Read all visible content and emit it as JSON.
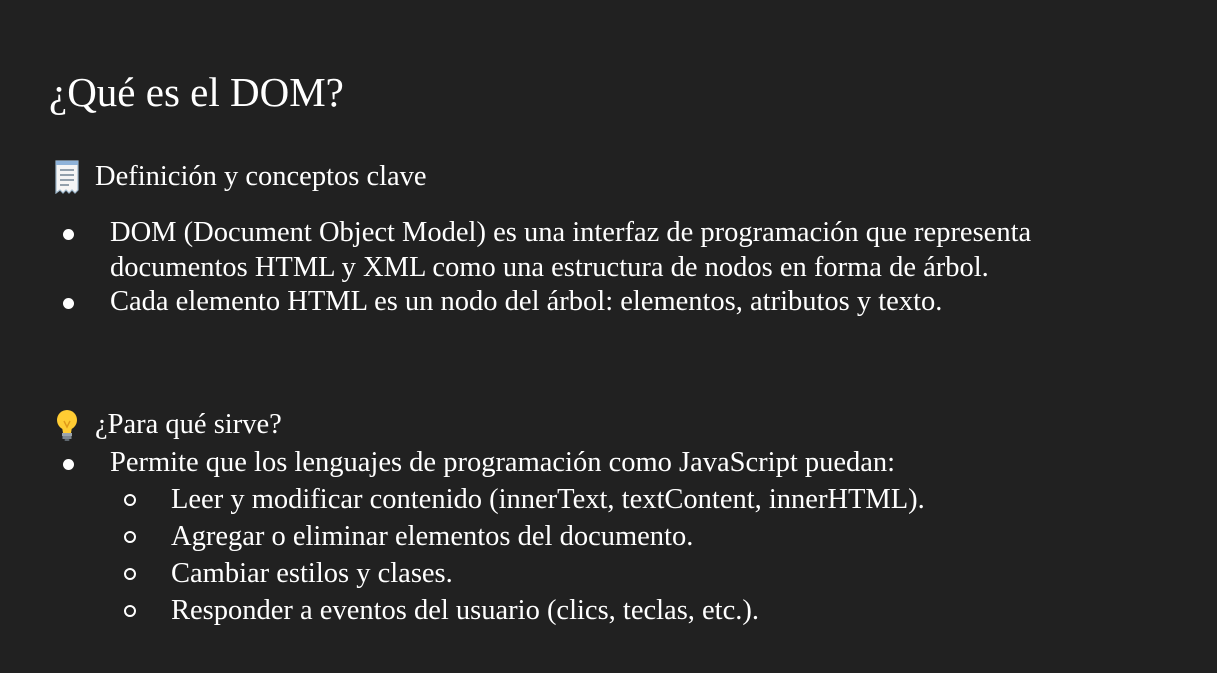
{
  "slide": {
    "title": "¿Qué es el DOM?",
    "sections": [
      {
        "icon": "receipt-icon",
        "heading": "Definición y conceptos clave",
        "bullets": [
          "DOM (Document Object Model) es una interfaz de programación que representa documentos HTML y XML como una estructura de nodos en forma de árbol.",
          "Cada elemento HTML es un nodo del árbol: elementos, atributos y texto."
        ]
      },
      {
        "icon": "lightbulb-icon",
        "heading": "¿Para qué sirve?",
        "bullets": [
          "Permite que los lenguajes de programación como JavaScript puedan:"
        ],
        "sub_bullets": [
          "Leer y modificar contenido (innerText, textContent, innerHTML).",
          "Agregar o eliminar elementos del documento.",
          "Cambiar estilos y clases.",
          "Responder a eventos del usuario (clics, teclas, etc.)."
        ]
      }
    ]
  },
  "colors": {
    "background": "#212121",
    "text": "#ffffff"
  }
}
